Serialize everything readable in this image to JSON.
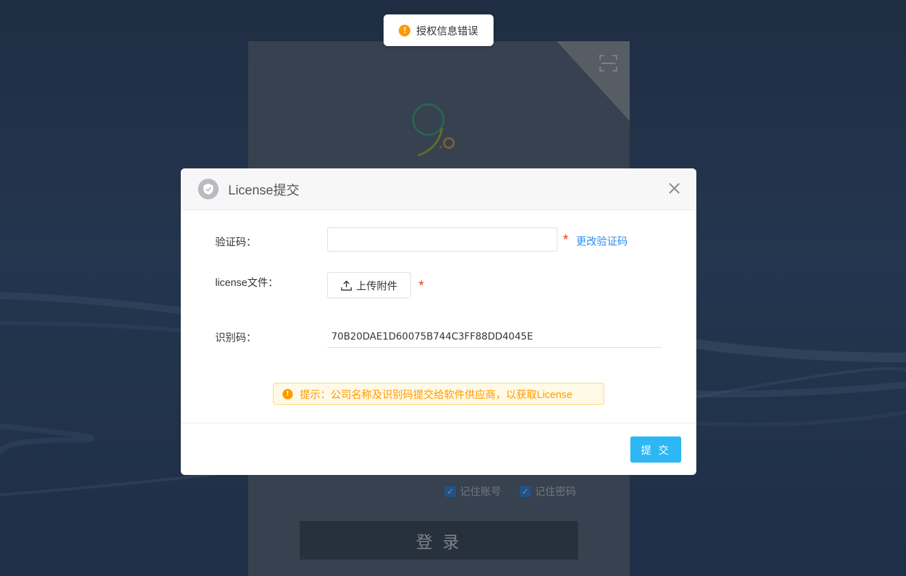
{
  "toast": {
    "icon": "warning-icon",
    "text": "授权信息错误"
  },
  "login": {
    "remember_account": "记住账号",
    "remember_password": "记住密码",
    "login_button": "登 录"
  },
  "modal": {
    "title": "License提交",
    "fields": {
      "verify_label": "验证码：",
      "verify_value": "",
      "change_code_link": "更改验证码",
      "license_label": "license文件：",
      "upload_button": "上传附件",
      "id_label": "识别码：",
      "id_value": "70B20DAE1D60075B744C3FF88DD4045E",
      "required_mark": "*"
    },
    "tip": "提示：公司名称及识别码提交给软件供应商，以获取License",
    "submit_button": "提 交"
  },
  "colors": {
    "primary": "#2db7f5",
    "warning": "#ff9900",
    "required": "#ed4014",
    "link": "#2d8cf0"
  }
}
